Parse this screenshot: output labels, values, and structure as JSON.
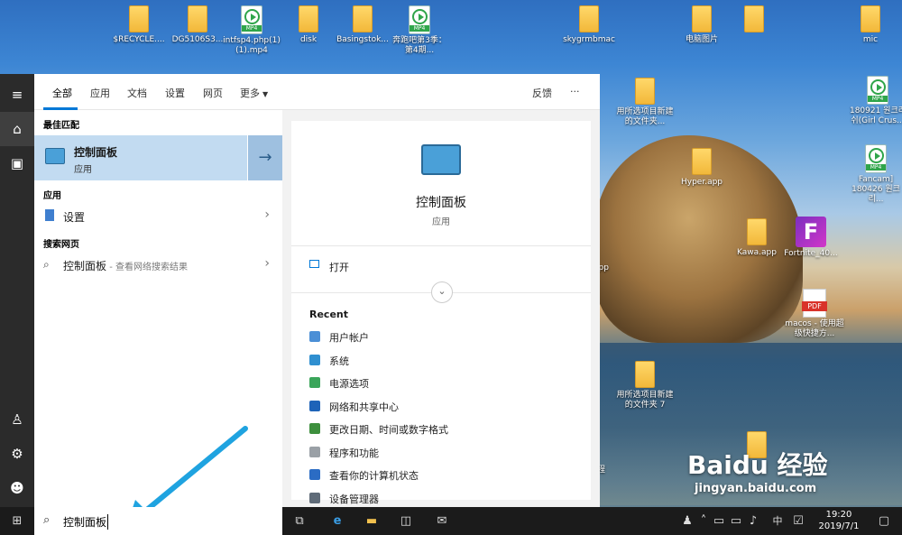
{
  "desktop_icons": [
    {
      "label": "$RECYCLE....",
      "type": "folder"
    },
    {
      "label": "DG5106S3...",
      "type": "folder"
    },
    {
      "label": "intfsp4.php(1)(1).mp4",
      "type": "mp4"
    },
    {
      "label": "disk",
      "type": "folder"
    },
    {
      "label": "Basingstok...",
      "type": "folder"
    },
    {
      "label": "奔跑吧第3季：第4期...",
      "type": "mp4"
    },
    {
      "label": "skygrmbmac",
      "type": "folder"
    },
    {
      "label": "电脑图片",
      "type": "folder"
    },
    {
      "label": "",
      "type": "folder"
    },
    {
      "label": "mic",
      "type": "folder"
    },
    {
      "label": "用所选项目新建的文件夹...",
      "type": "folder"
    },
    {
      "label": "180921 원크리쉬(Girl Crus...",
      "type": "mp4"
    },
    {
      "label": "Hyper.app",
      "type": "folder"
    },
    {
      "label": "Fancam] 180426 원크리...",
      "type": "mp4"
    },
    {
      "label": "Kawa.app",
      "type": "folder"
    },
    {
      "label": "Fortnite_40...",
      "type": "fortnite"
    },
    {
      "label": "macos - 使用超级快捷方...",
      "type": "pdf"
    },
    {
      "label": "用所选项目新建的文件夹 7",
      "type": "folder"
    },
    {
      "label": "",
      "type": "folder"
    }
  ],
  "mp4_tag": "MP4",
  "pdf_tag": "PDF",
  "fortnite_letter": "F",
  "partial_labels": {
    "app": "app",
    "cheng": "程"
  },
  "tabs": {
    "all": "全部",
    "apps": "应用",
    "docs": "文档",
    "settings": "设置",
    "web": "网页",
    "more": "更多",
    "feedback": "反馈",
    "ellipsis": "···"
  },
  "left": {
    "best_match": "最佳匹配",
    "best_title": "控制面板",
    "best_sub": "应用",
    "apps_header": "应用",
    "settings_label": "设置",
    "web_header": "搜索网页",
    "web_query": "控制面板",
    "web_hint": " - 查看网络搜索结果"
  },
  "right": {
    "title": "控制面板",
    "sub": "应用",
    "open": "打开",
    "recent_header": "Recent",
    "recent": [
      "用户帐户",
      "系统",
      "电源选项",
      "网络和共享中心",
      "更改日期、时间或数字格式",
      "程序和功能",
      "查看你的计算机状态",
      "设备管理器"
    ]
  },
  "search": {
    "value": "控制面板"
  },
  "tray": {
    "ime": "中",
    "time": "19:20",
    "date": "2019/7/1"
  },
  "watermark": {
    "brand": "Baidu 经验",
    "url": "jingyan.baidu.com"
  }
}
